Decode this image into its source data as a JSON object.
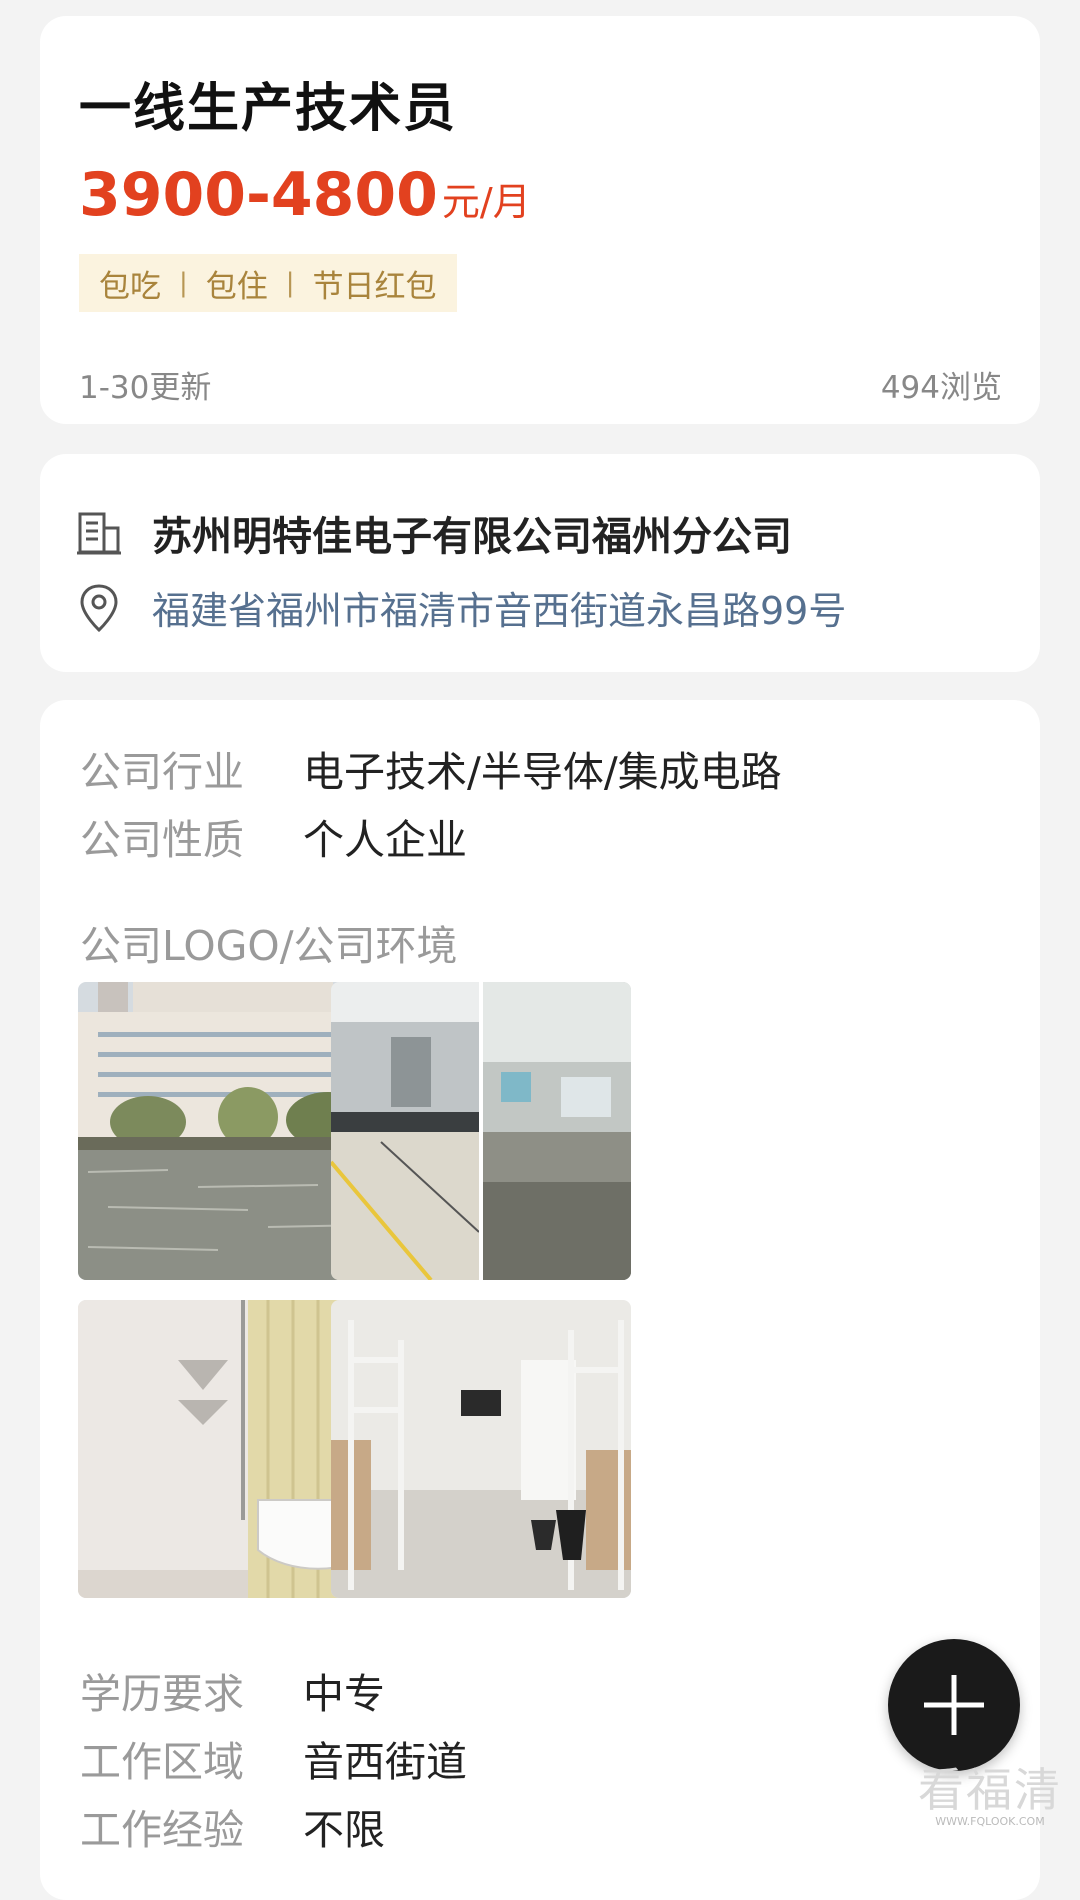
{
  "job": {
    "title": "一线生产技术员",
    "salary_range": "3900-4800",
    "salary_unit": "元/月",
    "benefits": [
      "包吃",
      "包住",
      "节日红包"
    ],
    "benefit_separator": "|",
    "updated": "1-30更新",
    "views": "494浏览"
  },
  "company": {
    "name": "苏州明特佳电子有限公司福州分公司",
    "address": "福建省福州市福清市音西街道永昌路99号",
    "building_icon": "building-icon",
    "location_icon": "location-pin-icon"
  },
  "details": {
    "industry_label": "公司行业",
    "industry_value": "电子技术/半导体/集成电路",
    "nature_label": "公司性质",
    "nature_value": "个人企业",
    "photos_label": "公司LOGO/公司环境",
    "photos": [
      "factory-lake-photo",
      "factory-floor-photo",
      "bathroom-photo",
      "dormitory-photo"
    ],
    "education_label": "学历要求",
    "education_value": "中专",
    "area_label": "工作区域",
    "area_value": "音西街道",
    "experience_label": "工作经验",
    "experience_value": "不限"
  },
  "fab": {
    "icon": "plus-icon"
  },
  "watermark": {
    "text": "看福清",
    "url": "WWW.FQLOOK.COM"
  },
  "colors": {
    "salary": "#e2411f",
    "benefit_bg": "#fbf3df",
    "benefit_text": "#a9843c",
    "address": "#56708f",
    "background": "#f3f3f3"
  }
}
